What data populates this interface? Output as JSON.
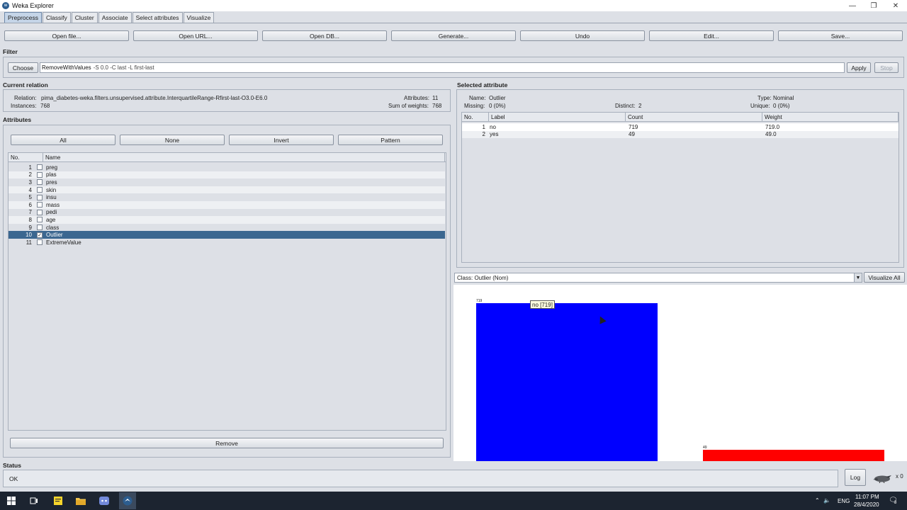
{
  "window": {
    "title": "Weka Explorer",
    "minimize": "—",
    "restore": "❐",
    "close": "✕"
  },
  "tabs": [
    "Preprocess",
    "Classify",
    "Cluster",
    "Associate",
    "Select attributes",
    "Visualize"
  ],
  "toolbar": {
    "open_file": "Open file...",
    "open_url": "Open URL...",
    "open_db": "Open DB...",
    "generate": "Generate...",
    "undo": "Undo",
    "edit": "Edit...",
    "save": "Save..."
  },
  "filter": {
    "section": "Filter",
    "choose": "Choose",
    "name": "RemoveWithValues",
    "options": "-S 0.0 -C last -L first-last",
    "apply": "Apply",
    "stop": "Stop"
  },
  "relation": {
    "section": "Current relation",
    "relation_label": "Relation:",
    "relation_value": "pima_diabetes-weka.filters.unsupervised.attribute.InterquartileRange-Rfirst-last-O3.0-E6.0",
    "instances_label": "Instances:",
    "instances_value": "768",
    "attributes_label": "Attributes:",
    "attributes_value": "11",
    "weights_label": "Sum of weights:",
    "weights_value": "768"
  },
  "attributes": {
    "section": "Attributes",
    "buttons": {
      "all": "All",
      "none": "None",
      "invert": "Invert",
      "pattern": "Pattern"
    },
    "columns": {
      "no": "No.",
      "name": "Name"
    },
    "rows": [
      {
        "no": "1",
        "name": "preg",
        "checked": ""
      },
      {
        "no": "2",
        "name": "plas",
        "checked": ""
      },
      {
        "no": "3",
        "name": "pres",
        "checked": ""
      },
      {
        "no": "4",
        "name": "skin",
        "checked": ""
      },
      {
        "no": "5",
        "name": "insu",
        "checked": ""
      },
      {
        "no": "6",
        "name": "mass",
        "checked": ""
      },
      {
        "no": "7",
        "name": "pedi",
        "checked": ""
      },
      {
        "no": "8",
        "name": "age",
        "checked": ""
      },
      {
        "no": "9",
        "name": "class",
        "checked": ""
      },
      {
        "no": "10",
        "name": "Outlier",
        "checked": "✓"
      },
      {
        "no": "11",
        "name": "ExtremeValue",
        "checked": ""
      }
    ],
    "remove": "Remove"
  },
  "selected": {
    "section": "Selected attribute",
    "name_label": "Name:",
    "name_value": "Outlier",
    "type_label": "Type:",
    "type_value": "Nominal",
    "missing_label": "Missing:",
    "missing_value": "0 (0%)",
    "distinct_label": "Distinct:",
    "distinct_value": "2",
    "unique_label": "Unique:",
    "unique_value": "0 (0%)",
    "columns": {
      "no": "No.",
      "label": "Label",
      "count": "Count",
      "weight": "Weight"
    },
    "rows": [
      {
        "no": "1",
        "label": "no",
        "count": "719",
        "weight": "719.0"
      },
      {
        "no": "2",
        "label": "yes",
        "count": "49",
        "weight": "49.0"
      }
    ]
  },
  "class_combo": {
    "value": "Class: Outlier (Nom)",
    "visualize_all": "Visualize All"
  },
  "histogram": {
    "tooltip": "no [719]",
    "bar_no_label": "719",
    "bar_yes_label": "49",
    "colors": {
      "no": "#0000ff",
      "yes": "#ff0000"
    }
  },
  "chart_data": {
    "type": "bar",
    "categories": [
      "no",
      "yes"
    ],
    "values": [
      719,
      49
    ],
    "title": "",
    "xlabel": "",
    "ylabel": ""
  },
  "status": {
    "section": "Status",
    "text": "OK",
    "log": "Log",
    "count": "x 0"
  },
  "taskbar": {
    "lang": "ENG",
    "time": "11:07 PM",
    "date": "28/4/2020",
    "notif": "3"
  }
}
